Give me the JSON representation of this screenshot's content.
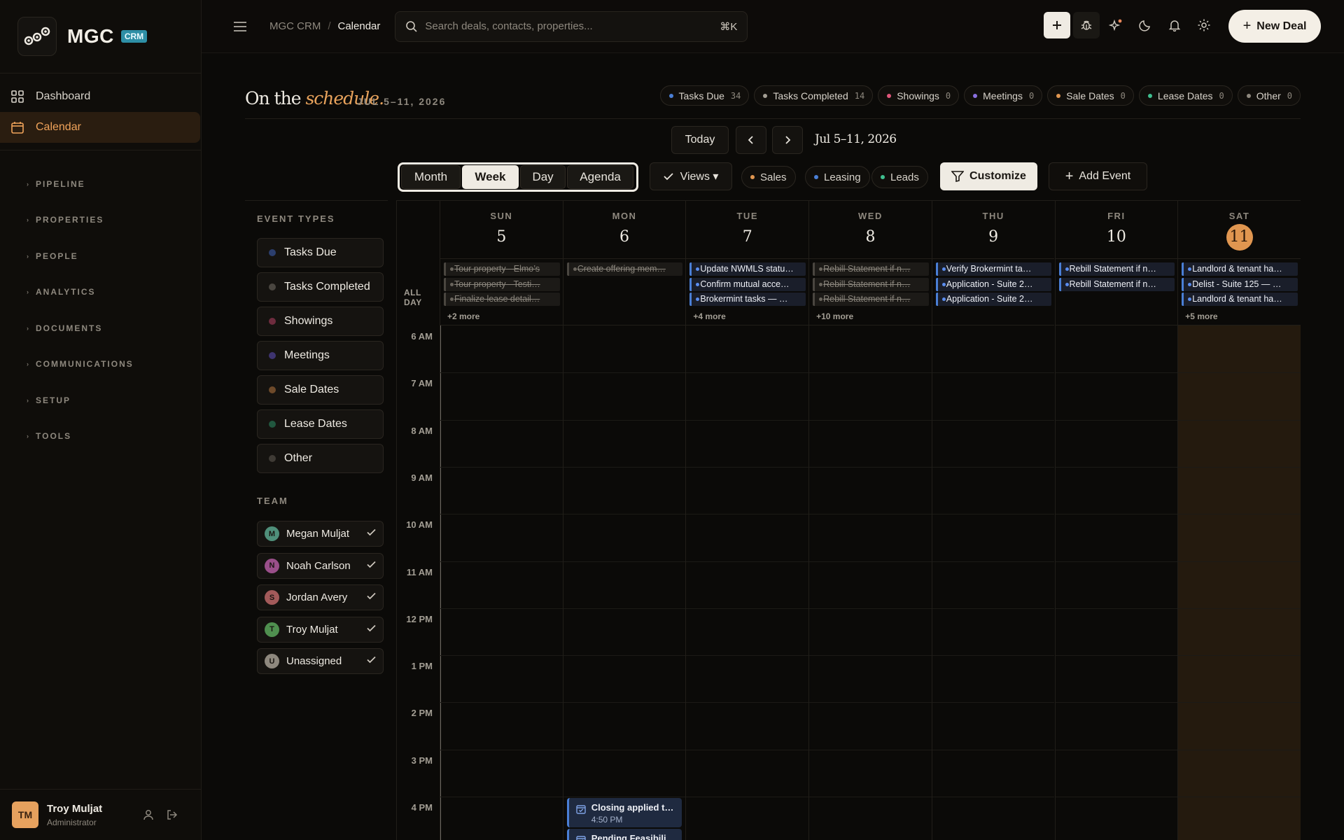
{
  "brand": {
    "name": "MGC",
    "badge": "CRM"
  },
  "nav": {
    "main": [
      {
        "label": "Dashboard",
        "icon": "grid-icon"
      },
      {
        "label": "Calendar",
        "icon": "calendar-icon",
        "active": true
      }
    ],
    "groups": [
      "PIPELINE",
      "PROPERTIES",
      "PEOPLE",
      "ANALYTICS",
      "DOCUMENTS",
      "COMMUNICATIONS",
      "SETUP",
      "TOOLS"
    ]
  },
  "user": {
    "initials": "TM",
    "name": "Troy Muljat",
    "role": "Administrator"
  },
  "topbar": {
    "breadcrumb": [
      "MGC CRM",
      "Calendar"
    ],
    "search_placeholder": "Search deals, contacts, properties...",
    "search_shortcut": "⌘K",
    "new_deal_label": "New Deal"
  },
  "header": {
    "title_a": "On the",
    "title_b": "schedule.",
    "date_range": "JUL 5–11, 2026",
    "chips": [
      {
        "label": "Tasks Due",
        "count": "34",
        "color": "#4a7fd6"
      },
      {
        "label": "Tasks Completed",
        "count": "14",
        "color": "#a39e94"
      },
      {
        "label": "Showings",
        "count": "0",
        "color": "#e0567a"
      },
      {
        "label": "Meetings",
        "count": "0",
        "color": "#8a70e0"
      },
      {
        "label": "Sale Dates",
        "count": "0",
        "color": "#e09650"
      },
      {
        "label": "Lease Dates",
        "count": "0",
        "color": "#3fbf8f"
      },
      {
        "label": "Other",
        "count": "0",
        "color": "#8e887e"
      }
    ]
  },
  "toolbar": {
    "today": "Today",
    "range_label": "Jul 5–11, 2026",
    "views": [
      "Month",
      "Week",
      "Day",
      "Agenda"
    ],
    "active_view": "Week",
    "views_menu": "Views ▾",
    "pills": [
      {
        "label": "Sales",
        "color": "#e09650"
      },
      {
        "label": "Leasing",
        "color": "#4a7fd6"
      },
      {
        "label": "Leads",
        "color": "#3fbf8f"
      }
    ],
    "customize": "Customize",
    "add_event": "Add Event"
  },
  "filters": {
    "event_types_title": "EVENT TYPES",
    "event_types": [
      {
        "label": "Tasks Due",
        "color": "#2c3f6e"
      },
      {
        "label": "Tasks Completed",
        "color": "#4a4640"
      },
      {
        "label": "Showings",
        "color": "#6e2c3e"
      },
      {
        "label": "Meetings",
        "color": "#3e3470"
      },
      {
        "label": "Sale Dates",
        "color": "#6e4a2a"
      },
      {
        "label": "Lease Dates",
        "color": "#21573f"
      },
      {
        "label": "Other",
        "color": "#3f3b35"
      }
    ],
    "team_title": "TEAM",
    "team": [
      {
        "initial": "M",
        "name": "Megan Muljat",
        "color": "#4f8f7a"
      },
      {
        "initial": "N",
        "name": "Noah Carlson",
        "color": "#9a4f8a"
      },
      {
        "initial": "S",
        "name": "Jordan Avery",
        "color": "#a35a5a"
      },
      {
        "initial": "T",
        "name": "Troy Muljat",
        "color": "#4f8f4f"
      },
      {
        "initial": "U",
        "name": "Unassigned",
        "color": "#8e887e"
      }
    ]
  },
  "calendar": {
    "all_day_label": "ALL DAY",
    "hours": [
      "6 AM",
      "7 AM",
      "8 AM",
      "9 AM",
      "10 AM",
      "11 AM",
      "12 PM",
      "1 PM",
      "2 PM",
      "3 PM",
      "4 PM"
    ],
    "days": [
      {
        "dow": "SUN",
        "num": "5",
        "more": "+2 more",
        "events": [
          {
            "title": "Tour property - Elmo’s",
            "done": true
          },
          {
            "title": "Tour property - Testi…",
            "done": true
          },
          {
            "title": "Finalize lease detail…",
            "done": true
          }
        ]
      },
      {
        "dow": "MON",
        "num": "6",
        "more": "",
        "events": [
          {
            "title": "Create offering mem…",
            "done": true
          }
        ]
      },
      {
        "dow": "TUE",
        "num": "7",
        "more": "+4 more",
        "events": [
          {
            "title": "Update NWMLS statu…",
            "done": false
          },
          {
            "title": "Confirm mutual acce…",
            "done": false
          },
          {
            "title": "Brokermint tasks — …",
            "done": false
          }
        ]
      },
      {
        "dow": "WED",
        "num": "8",
        "more": "+10 more",
        "events": [
          {
            "title": "Rebill Statement if n…",
            "done": true
          },
          {
            "title": "Rebill Statement if n…",
            "done": true
          },
          {
            "title": "Rebill Statement if n…",
            "done": true
          }
        ]
      },
      {
        "dow": "THU",
        "num": "9",
        "more": "",
        "events": [
          {
            "title": "Verify Brokermint ta…",
            "done": false
          },
          {
            "title": "Application - Suite 2…",
            "done": false
          },
          {
            "title": "Application - Suite 2…",
            "done": false
          }
        ]
      },
      {
        "dow": "FRI",
        "num": "10",
        "more": "",
        "events": [
          {
            "title": "Rebill Statement if n…",
            "done": false
          },
          {
            "title": "Rebill Statement if n…",
            "done": false
          }
        ]
      },
      {
        "dow": "SAT",
        "num": "11",
        "today": true,
        "more": "+5 more",
        "events": [
          {
            "title": "Landlord & tenant ha…",
            "done": false
          },
          {
            "title": "Delist - Suite 125 — …",
            "done": false
          },
          {
            "title": "Landlord & tenant ha…",
            "done": false
          }
        ]
      }
    ],
    "timed_events": [
      {
        "title": "Closing applied t…",
        "time": "4:50 PM"
      },
      {
        "title": "Pending Feasibili…",
        "time": ""
      }
    ]
  }
}
